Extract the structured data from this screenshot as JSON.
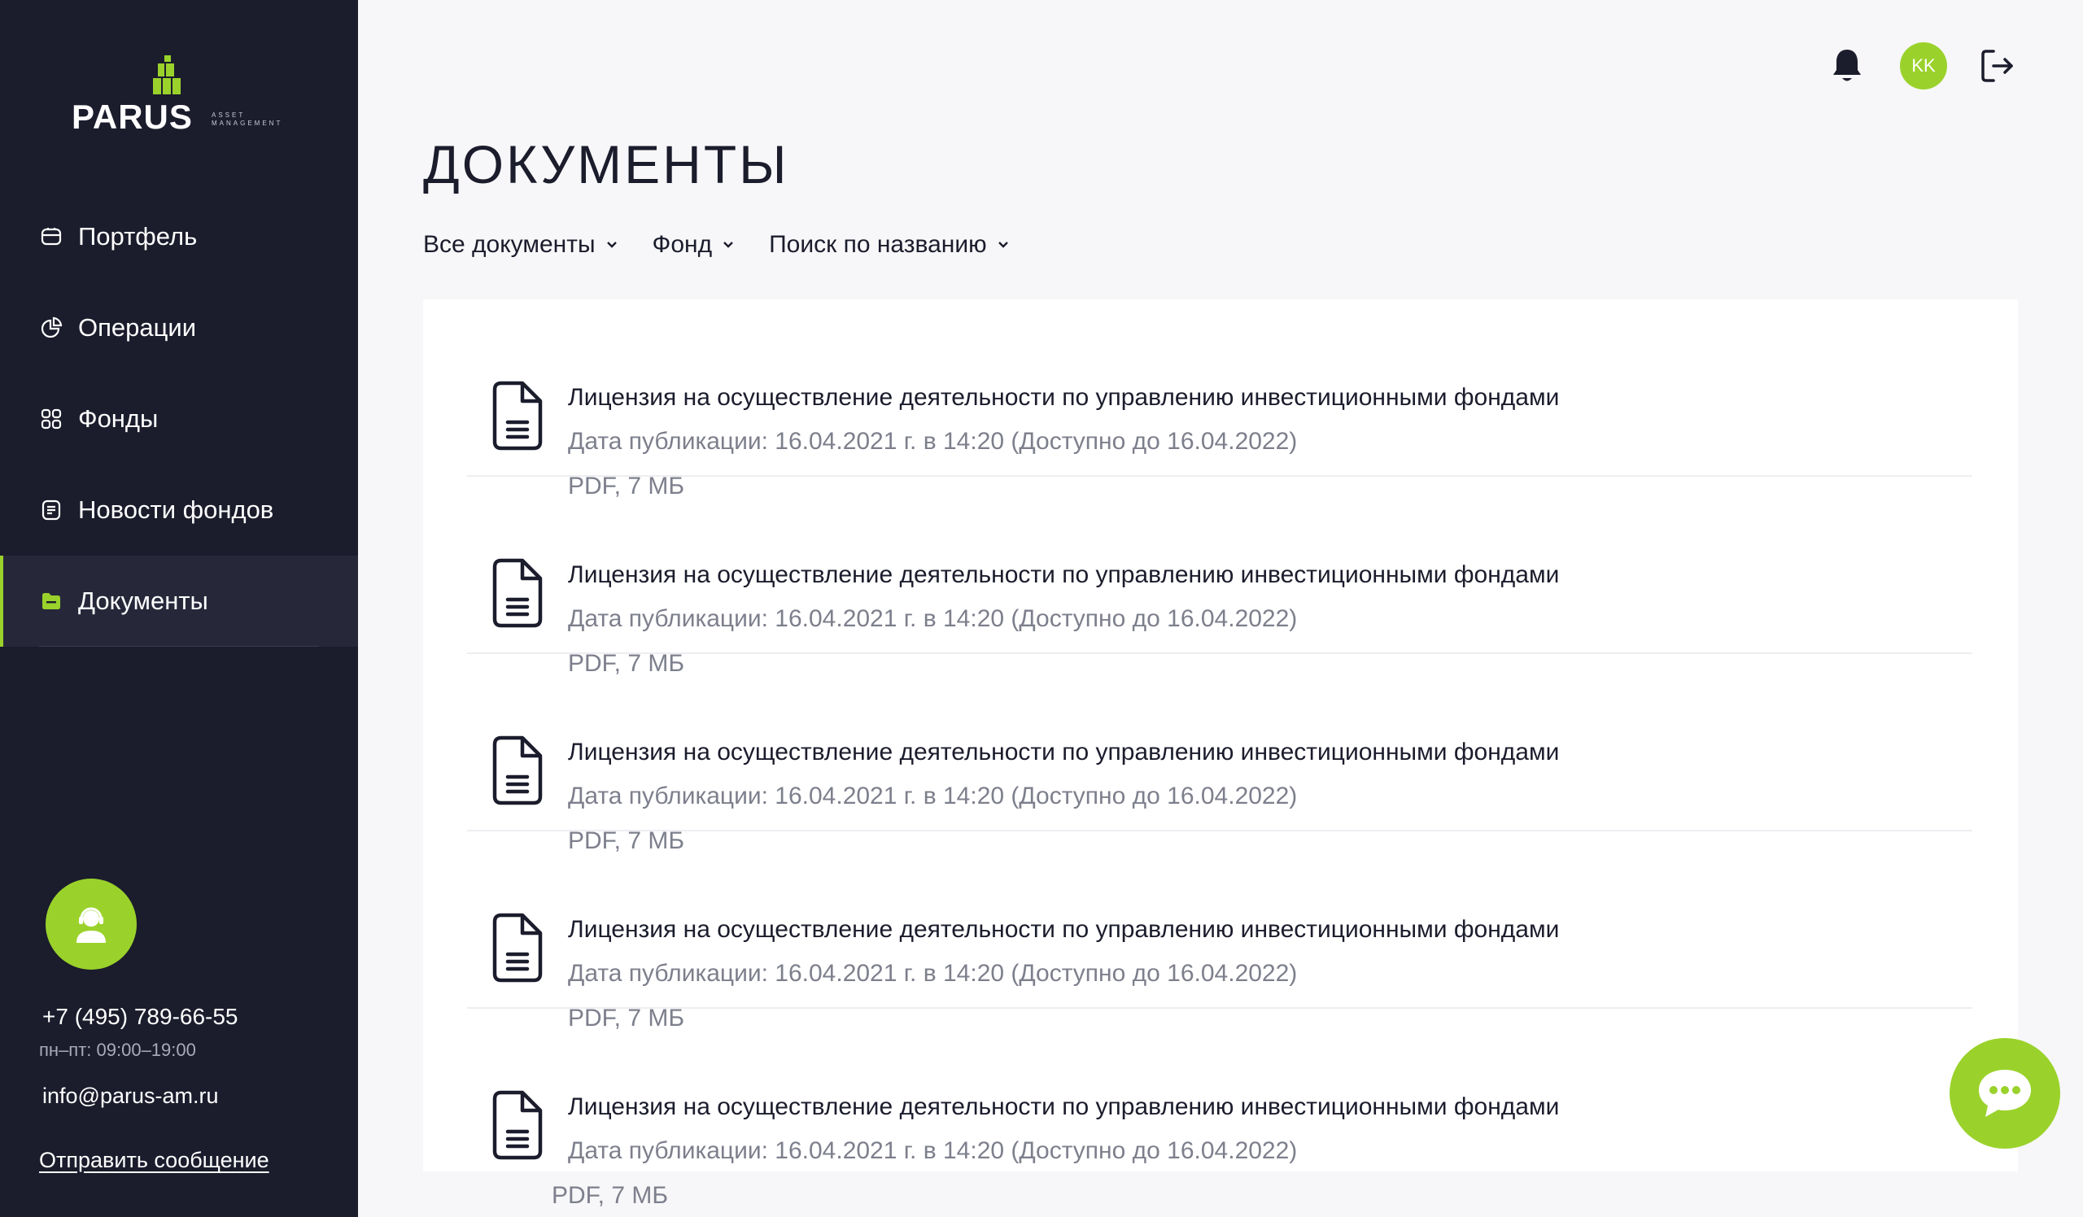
{
  "brand": {
    "name": "PARUS",
    "sub_line1": "ASSET",
    "sub_line2": "MANAGEMENT",
    "accent": "#9ad22b",
    "sidebar_bg": "#1b1c2c"
  },
  "sidebar": {
    "items": [
      {
        "label": "Портфель",
        "icon": "wallet-icon",
        "active": false
      },
      {
        "label": "Операции",
        "icon": "pie-chart-icon",
        "active": false
      },
      {
        "label": "Фонды",
        "icon": "grid-icon",
        "active": false
      },
      {
        "label": "Новости фондов",
        "icon": "news-icon",
        "active": false
      },
      {
        "label": "Документы",
        "icon": "folder-icon",
        "active": true
      }
    ],
    "contact": {
      "phone": "+7 (495) 789-66-55",
      "hours": "пн–пт: 09:00–19:00",
      "email": "info@parus-am.ru",
      "send_label": "Отправить сообщение"
    }
  },
  "header": {
    "avatar_initials": "KK"
  },
  "page": {
    "title": "ДОКУМЕНТЫ"
  },
  "filters": [
    {
      "label": "Все документы"
    },
    {
      "label": "Фонд"
    },
    {
      "label": "Поиск по названию"
    }
  ],
  "documents": [
    {
      "title": "Лицензия на осуществление деятельности по управлению инвестиционными фондами",
      "date": "Дата публикации: 16.04.2021 г. в 14:20 (Доступно до 16.04.2022)",
      "meta": "PDF, 7 МБ"
    },
    {
      "title": "Лицензия на осуществление деятельности по управлению инвестиционными фондами",
      "date": "Дата публикации: 16.04.2021 г. в 14:20 (Доступно до 16.04.2022)",
      "meta": "PDF, 7 МБ"
    },
    {
      "title": "Лицензия на осуществление деятельности по управлению инвестиционными фондами",
      "date": "Дата публикации: 16.04.2021 г. в 14:20 (Доступно до 16.04.2022)",
      "meta": "PDF, 7 МБ"
    },
    {
      "title": "Лицензия на осуществление деятельности по управлению инвестиционными фондами",
      "date": "Дата публикации: 16.04.2021 г. в 14:20 (Доступно до 16.04.2022)",
      "meta": "PDF, 7 МБ"
    },
    {
      "title": "Лицензия на осуществление деятельности по управлению инвестиционными фондами",
      "date": "Дата публикации: 16.04.2021 г. в 14:20 (Доступно до 16.04.2022)",
      "meta": "PDF, 7 МБ"
    }
  ]
}
